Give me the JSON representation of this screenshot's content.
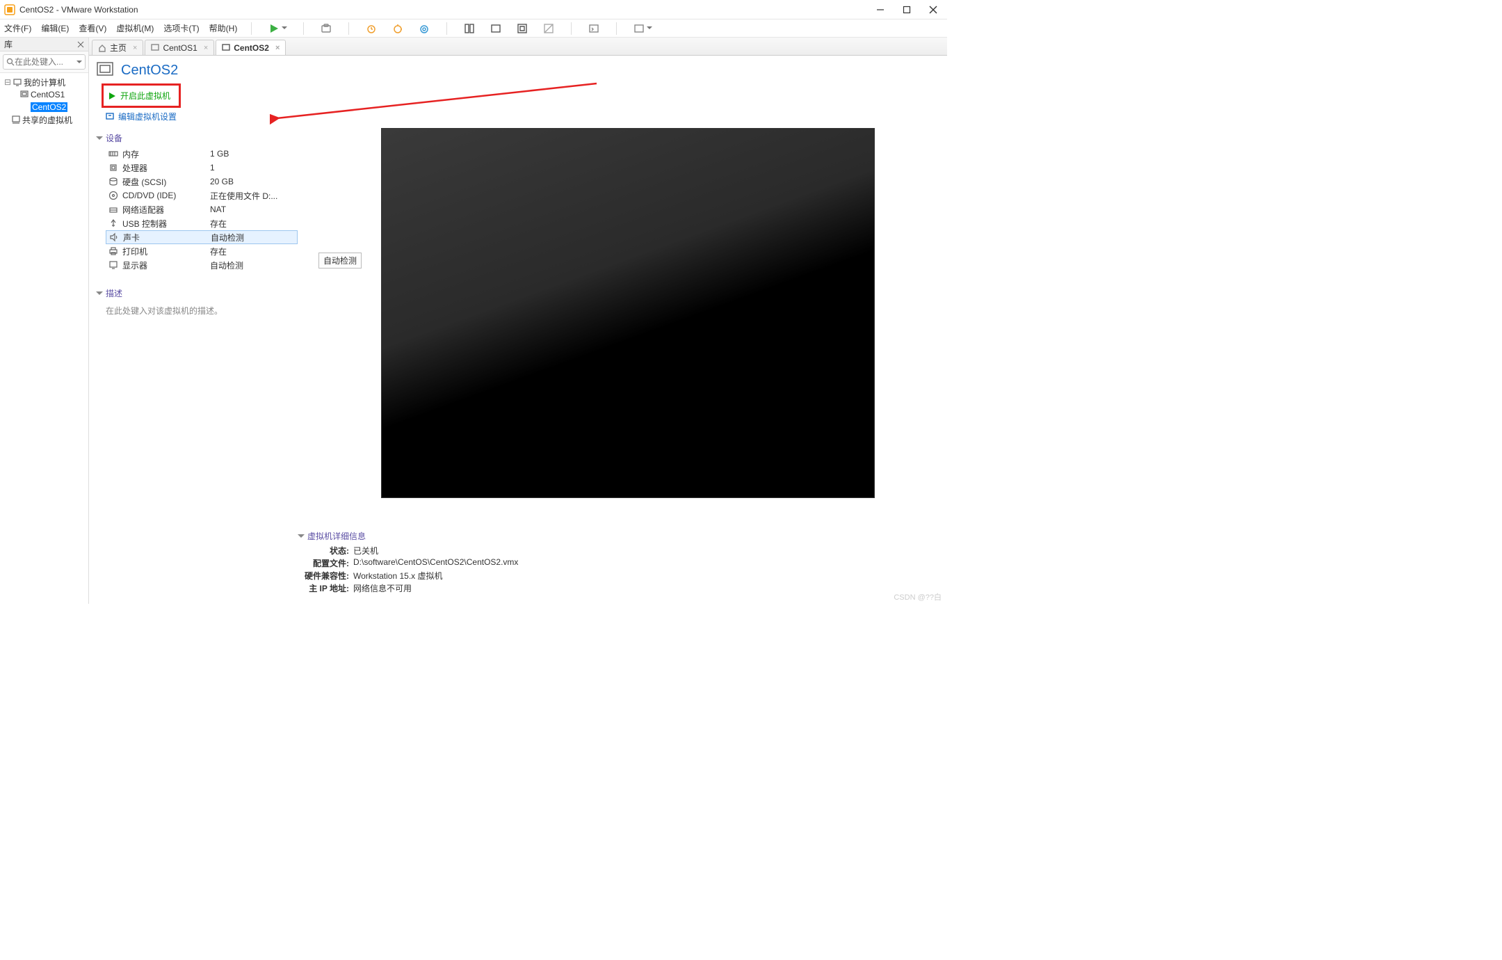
{
  "window": {
    "title": "CentOS2 - VMware Workstation"
  },
  "menu": {
    "items": [
      "文件(F)",
      "编辑(E)",
      "查看(V)",
      "虚拟机(M)",
      "选项卡(T)",
      "帮助(H)"
    ]
  },
  "sidebar": {
    "title": "库",
    "search_placeholder": "在此处键入...",
    "root": "我的计算机",
    "items": [
      "CentOS1",
      "CentOS2"
    ],
    "shared": "共享的虚拟机"
  },
  "tabs": [
    {
      "label": "主页",
      "icon": "home"
    },
    {
      "label": "CentOS1",
      "icon": "vm"
    },
    {
      "label": "CentOS2",
      "icon": "vm",
      "active": true
    }
  ],
  "vm": {
    "title": "CentOS2",
    "actions": {
      "power_on": "开启此虚拟机",
      "edit_settings": "编辑虚拟机设置"
    },
    "sections": {
      "devices": "设备",
      "description": "描述",
      "details": "虚拟机详细信息"
    },
    "devices": [
      {
        "icon": "memory",
        "label": "内存",
        "value": "1 GB"
      },
      {
        "icon": "cpu",
        "label": "处理器",
        "value": "1"
      },
      {
        "icon": "disk",
        "label": "硬盘 (SCSI)",
        "value": "20 GB"
      },
      {
        "icon": "disc",
        "label": "CD/DVD (IDE)",
        "value": "正在使用文件 D:..."
      },
      {
        "icon": "net",
        "label": "网络适配器",
        "value": "NAT"
      },
      {
        "icon": "usb",
        "label": "USB 控制器",
        "value": "存在"
      },
      {
        "icon": "sound",
        "label": "声卡",
        "value": "自动检测",
        "selected": true
      },
      {
        "icon": "printer",
        "label": "打印机",
        "value": "存在"
      },
      {
        "icon": "display",
        "label": "显示器",
        "value": "自动检测"
      }
    ],
    "tooltip": "自动检测",
    "description_placeholder": "在此处键入对该虚拟机的描述。",
    "details": [
      {
        "key": "状态:",
        "value": "已关机"
      },
      {
        "key": "配置文件:",
        "value": "D:\\software\\CentOS\\CentOS2\\CentOS2.vmx"
      },
      {
        "key": "硬件兼容性:",
        "value": "Workstation 15.x 虚拟机"
      },
      {
        "key": "主 IP 地址:",
        "value": "网络信息不可用"
      }
    ]
  },
  "watermark": "CSDN @??白"
}
